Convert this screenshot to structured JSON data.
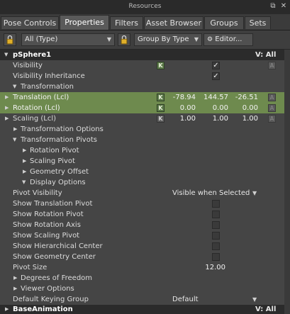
{
  "window": {
    "title": "Resources"
  },
  "tabs": [
    {
      "label": "Pose Controls"
    },
    {
      "label": "Properties",
      "active": true
    },
    {
      "label": "Filters"
    },
    {
      "label": "Asset Browser"
    },
    {
      "label": "Groups"
    },
    {
      "label": "Sets"
    }
  ],
  "toolbar": {
    "filter_value": "All (Type)",
    "group_value": "Group By Type",
    "editor_label": "Editor..."
  },
  "object": {
    "name": "pSphere1",
    "visibility_label": "V: All"
  },
  "props": {
    "visibility": "Visibility",
    "visibility_inheritance": "Visibility Inheritance",
    "transformation": "Transformation",
    "translation": {
      "label": "Translation (Lcl)",
      "x": "-78.94",
      "y": "144.57",
      "z": "-26.51"
    },
    "rotation": {
      "label": "Rotation (Lcl)",
      "x": "0.00",
      "y": "0.00",
      "z": "0.00"
    },
    "scaling": {
      "label": "Scaling (Lcl)",
      "x": "1.00",
      "y": "1.00",
      "z": "1.00"
    },
    "transformation_options": "Transformation Options",
    "transformation_pivots": "Transformation Pivots",
    "rotation_pivot": "Rotation Pivot",
    "scaling_pivot": "Scaling Pivot",
    "geometry_offset": "Geometry Offset",
    "display_options": "Display Options",
    "pivot_visibility": {
      "label": "Pivot Visibility",
      "value": "Visible when Selected"
    },
    "show_translation_pivot": "Show Translation Pivot",
    "show_rotation_pivot": "Show Rotation Pivot",
    "show_rotation_axis": "Show Rotation Axis",
    "show_scaling_pivot": "Show Scaling Pivot",
    "show_hierarchical_center": "Show Hierarchical Center",
    "show_geometry_center": "Show Geometry Center",
    "pivot_size": {
      "label": "Pivot Size",
      "value": "12.00"
    },
    "degrees_of_freedom": "Degrees of Freedom",
    "viewer_options": "Viewer Options",
    "default_keying_group": {
      "label": "Default Keying Group",
      "value": "Default"
    }
  },
  "footer": {
    "name": "BaseAnimation",
    "visibility_label": "V: All"
  },
  "glyphs": {
    "k": "K",
    "a": "A",
    "check": "✓"
  }
}
